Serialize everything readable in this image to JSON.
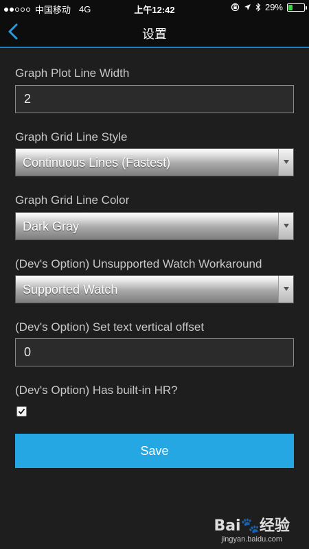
{
  "status_bar": {
    "carrier": "中国移动",
    "network": "4G",
    "time": "上午12:42",
    "battery": "29%",
    "battery_level": 0.29,
    "battery_color": "#3fd14b",
    "icons": [
      "rotation-lock-icon",
      "location-arrow-icon",
      "bluetooth-icon",
      "battery-icon"
    ]
  },
  "nav": {
    "title": "设置",
    "back_icon": "chevron-left-icon",
    "accent_color": "#1f7fc4"
  },
  "form": {
    "plot_line_width": {
      "label": "Graph Plot Line Width",
      "value": "2"
    },
    "grid_line_style": {
      "label": "Graph Grid Line Style",
      "selected": "Continuous Lines (Fastest)"
    },
    "grid_line_color": {
      "label": "Graph Grid Line Color",
      "selected": "Dark Gray"
    },
    "watch_workaround": {
      "label": "(Dev's Option) Unsupported Watch Workaround",
      "selected": "Supported Watch"
    },
    "text_offset": {
      "label": "(Dev's Option) Set text vertical offset",
      "value": "0"
    },
    "builtin_hr": {
      "label": "(Dev's Option) Has built-in HR?",
      "checked": true
    },
    "save_label": "Save",
    "save_color": "#24a7e3"
  },
  "watermark": {
    "logo": "Bai🐾经验",
    "url": "jingyan.baidu.com"
  }
}
